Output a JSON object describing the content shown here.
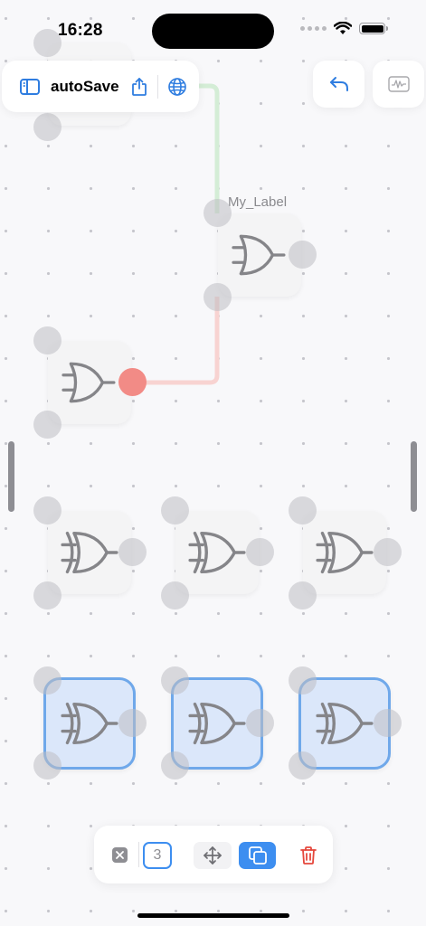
{
  "status_bar": {
    "time": "16:28"
  },
  "toolbar": {
    "title": "autoSave",
    "icons": [
      "sidebar-icon",
      "share-icon",
      "globe-icon"
    ]
  },
  "top_right": {
    "icons": [
      "undo-icon",
      "waveform-icon"
    ]
  },
  "canvas": {
    "label": "My_Label",
    "colors": {
      "active_wire": "#f28b86",
      "idle_wire": "#d4edd6",
      "selection": "#6fa8ea",
      "selection_fill": "#dbe7fa"
    },
    "gates": [
      {
        "name": "or-gate-top",
        "type": "or",
        "selected": false
      },
      {
        "name": "or-gate-labeled",
        "type": "or",
        "selected": false
      },
      {
        "name": "or-gate-left",
        "type": "or",
        "selected": false,
        "output_active": true
      },
      {
        "name": "xor-gate-row1-a",
        "type": "xor",
        "selected": false
      },
      {
        "name": "xor-gate-row1-b",
        "type": "xor",
        "selected": false
      },
      {
        "name": "xor-gate-row1-c",
        "type": "xor",
        "selected": false
      },
      {
        "name": "xor-gate-row2-a",
        "type": "xor",
        "selected": true
      },
      {
        "name": "xor-gate-row2-b",
        "type": "xor",
        "selected": true
      },
      {
        "name": "xor-gate-row2-c",
        "type": "xor",
        "selected": true
      }
    ]
  },
  "selection_bar": {
    "count": "3",
    "icons": [
      "clear-selection-icon",
      "move-icon",
      "duplicate-icon",
      "trash-icon"
    ],
    "accent": "#3d8ef0",
    "delete_color": "#e5473c"
  }
}
